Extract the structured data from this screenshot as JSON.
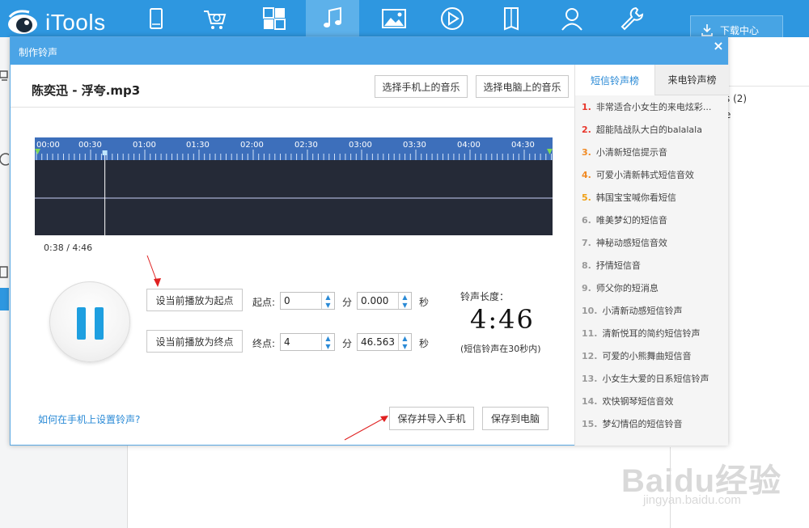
{
  "app": {
    "name": "iTools",
    "download_label": "下载中心"
  },
  "nav": [
    {
      "name": "device-icon"
    },
    {
      "name": "cart-icon"
    },
    {
      "name": "apps-icon"
    },
    {
      "name": "music-icon",
      "active": true
    },
    {
      "name": "photo-icon"
    },
    {
      "name": "video-icon"
    },
    {
      "name": "book-icon"
    },
    {
      "name": "contact-icon"
    },
    {
      "name": "tools-icon"
    }
  ],
  "background": {
    "right_text_1": "s (2)",
    "right_text_2": "e"
  },
  "dialog": {
    "title": "制作铃声",
    "close": "×",
    "song_title": "陈奕迅 - 浮夸.mp3",
    "btn_phone_music": "选择手机上的音乐",
    "btn_pc_music": "选择电脑上的音乐",
    "time_ticks": [
      "00:00",
      "00:30",
      "01:00",
      "01:30",
      "02:00",
      "02:30",
      "03:00",
      "03:30",
      "04:00",
      "04:30"
    ],
    "current_time": "0:38 / 4:46",
    "playhead_position_s": 38,
    "total_duration_s": 286,
    "btn_set_start": "设当前播放为起点",
    "btn_set_end": "设当前播放为终点",
    "start_label": "起点:",
    "end_label": "终点:",
    "minute_unit": "分",
    "second_unit": "秒",
    "start_min": "0",
    "start_sec": "0.000",
    "end_min": "4",
    "end_sec": "46.563",
    "length_title": "铃声长度：",
    "length_value": "4:46",
    "length_note": "(短信铃声在30秒内)",
    "help_link": "如何在手机上设置铃声?",
    "btn_save_import": "保存并导入手机",
    "btn_save_pc": "保存到电脑"
  },
  "ranking": {
    "tab_sms": "短信铃声榜",
    "tab_call": "来电铃声榜",
    "items": [
      {
        "num": "1.",
        "title": "非常适合小女生的来电炫彩...",
        "color": "#e8362b"
      },
      {
        "num": "2.",
        "title": "超能陆战队大白的balalala",
        "color": "#e8362b"
      },
      {
        "num": "3.",
        "title": "小清新短信提示音",
        "color": "#f08a24"
      },
      {
        "num": "4.",
        "title": "可爱小清新韩式短信音效",
        "color": "#f08a24"
      },
      {
        "num": "5.",
        "title": "韩国宝宝喊你看短信",
        "color": "#f0a014"
      },
      {
        "num": "6.",
        "title": "唯美梦幻的短信音",
        "color": "#999999"
      },
      {
        "num": "7.",
        "title": "神秘动感短信音效",
        "color": "#999999"
      },
      {
        "num": "8.",
        "title": "抒情短信音",
        "color": "#999999"
      },
      {
        "num": "9.",
        "title": "师父你的短消息",
        "color": "#999999"
      },
      {
        "num": "10.",
        "title": "小清新动感短信铃声",
        "color": "#999999"
      },
      {
        "num": "11.",
        "title": "清新悦耳的简约短信铃声",
        "color": "#999999"
      },
      {
        "num": "12.",
        "title": "可爱的小熊舞曲短信音",
        "color": "#999999"
      },
      {
        "num": "13.",
        "title": "小女生大爱的日系短信铃声",
        "color": "#999999"
      },
      {
        "num": "14.",
        "title": "欢快钢琴短信音效",
        "color": "#999999"
      },
      {
        "num": "15.",
        "title": "梦幻情侣的短信铃音",
        "color": "#999999"
      }
    ]
  },
  "watermark": {
    "text": "Baidu经验",
    "url": "jingyan.baidu.com"
  }
}
